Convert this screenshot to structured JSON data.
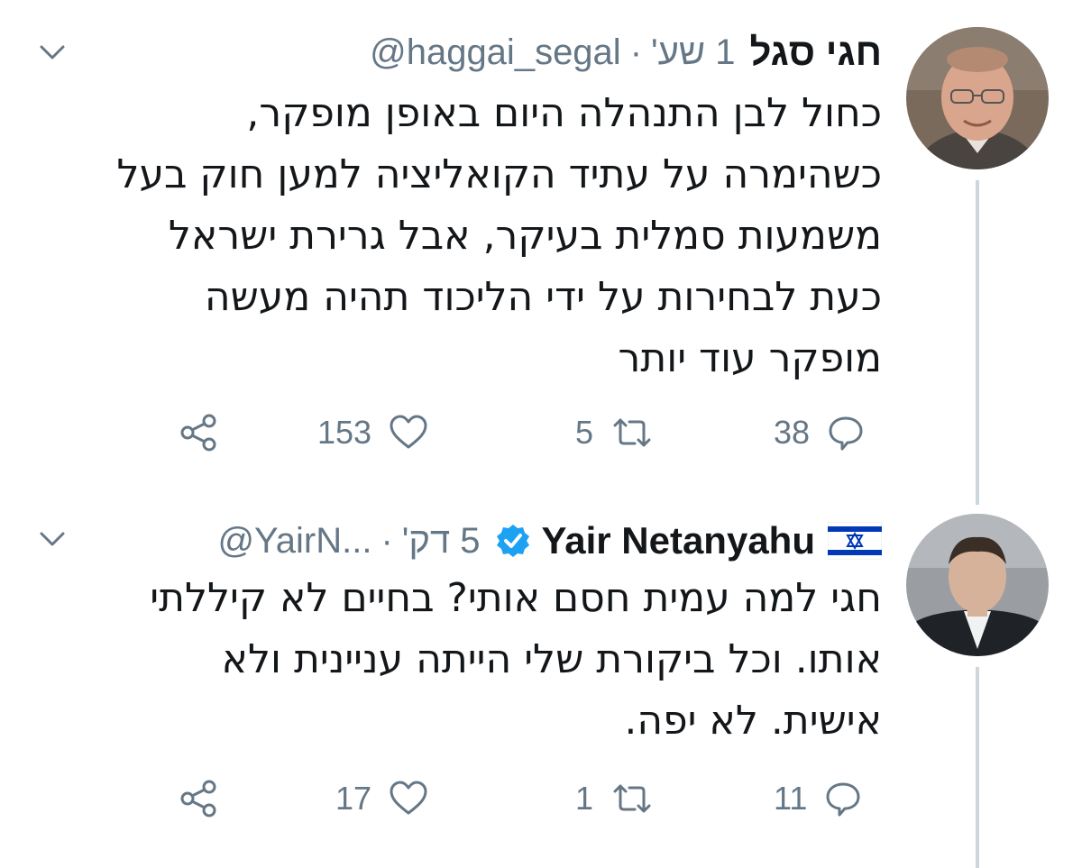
{
  "tweets": [
    {
      "author_name": "חגי סגל",
      "handle": "@haggai_segal",
      "separator": "·",
      "time": "1 שע'",
      "text_lines": [
        "כחול לבן התנהלה היום באופן מופקר,",
        "כשהימרה על עתיד הקואליציה למען חוק בעל",
        "משמעות סמלית בעיקר, אבל גרירת ישראל",
        "כעת לבחירות על ידי הליכוד תהיה מעשה",
        "מופקר עוד יותר"
      ],
      "replies": "38",
      "retweets": "5",
      "likes": "153"
    },
    {
      "author_name": "Yair Netanyahu",
      "handle": "@YairN...",
      "separator": "·",
      "time": "5 דק'",
      "text_lines": [
        "חגי למה עמית חסם אותי? בחיים לא קיללתי",
        "אותו. וכל ביקורת שלי הייתה עניינית ולא",
        "אישית. לא יפה."
      ],
      "replies": "11",
      "retweets": "1",
      "likes": "17"
    }
  ],
  "icons": {
    "chevron": "chevron-down-icon",
    "reply": "reply-icon",
    "retweet": "retweet-icon",
    "like": "heart-icon",
    "share": "share-icon",
    "verified": "verified-badge-icon",
    "flag": "israel-flag-icon"
  },
  "colors": {
    "text": "#14171a",
    "secondary": "#657786",
    "verified": "#1da1f2",
    "thread_line": "#ccd6dd",
    "flag_blue": "#0038b8"
  }
}
